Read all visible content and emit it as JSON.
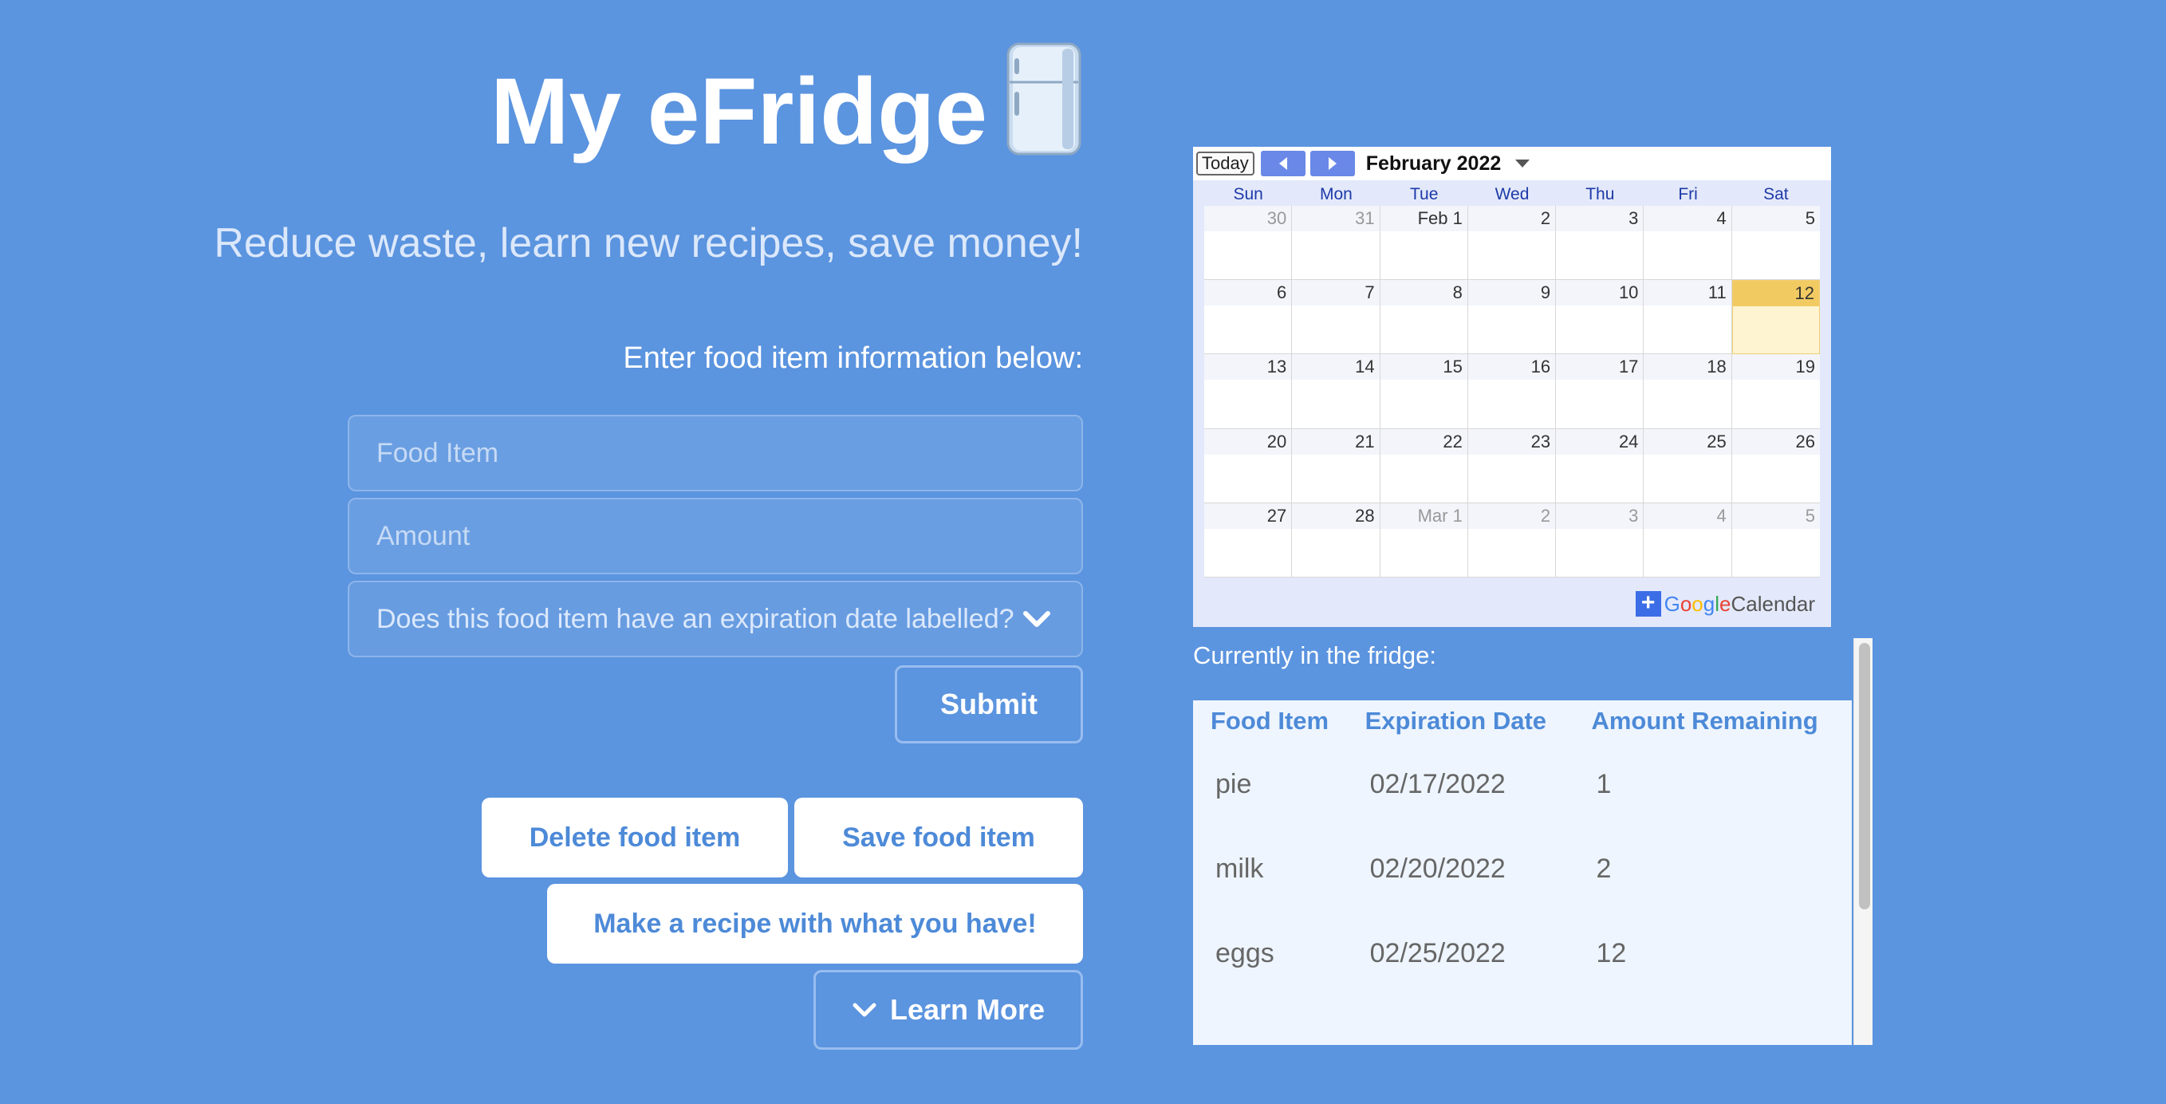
{
  "header": {
    "title": "My eFridge",
    "subtitle": "Reduce waste, learn new recipes, save money!"
  },
  "form": {
    "prompt": "Enter food item information below:",
    "food_item_placeholder": "Food Item",
    "amount_placeholder": "Amount",
    "expiration_select": "Does this food item have an expiration date labelled?",
    "submit_label": "Submit"
  },
  "actions": {
    "delete_label": "Delete food item",
    "save_label": "Save food item",
    "recipe_label": "Make a recipe with what you have!",
    "learn_more_label": "Learn More"
  },
  "calendar": {
    "today_label": "Today",
    "month_label": "February 2022",
    "weekdays": [
      "Sun",
      "Mon",
      "Tue",
      "Wed",
      "Thu",
      "Fri",
      "Sat"
    ],
    "weeks": [
      [
        {
          "d": "30",
          "o": true
        },
        {
          "d": "31",
          "o": true
        },
        {
          "d": "Feb 1"
        },
        {
          "d": "2"
        },
        {
          "d": "3"
        },
        {
          "d": "4"
        },
        {
          "d": "5"
        }
      ],
      [
        {
          "d": "6"
        },
        {
          "d": "7"
        },
        {
          "d": "8"
        },
        {
          "d": "9"
        },
        {
          "d": "10"
        },
        {
          "d": "11"
        },
        {
          "d": "12",
          "t": true
        }
      ],
      [
        {
          "d": "13"
        },
        {
          "d": "14"
        },
        {
          "d": "15"
        },
        {
          "d": "16"
        },
        {
          "d": "17"
        },
        {
          "d": "18"
        },
        {
          "d": "19"
        }
      ],
      [
        {
          "d": "20"
        },
        {
          "d": "21"
        },
        {
          "d": "22"
        },
        {
          "d": "23"
        },
        {
          "d": "24"
        },
        {
          "d": "25"
        },
        {
          "d": "26"
        }
      ],
      [
        {
          "d": "27"
        },
        {
          "d": "28"
        },
        {
          "d": "Mar 1",
          "o": true
        },
        {
          "d": "2",
          "o": true
        },
        {
          "d": "3",
          "o": true
        },
        {
          "d": "4",
          "o": true
        },
        {
          "d": "5",
          "o": true
        }
      ]
    ],
    "badge": {
      "google": "Google",
      "calendar": "Calendar"
    }
  },
  "fridge": {
    "label": "Currently in the fridge:",
    "columns": [
      "Food Item",
      "Expiration Date",
      "Amount Remaining"
    ],
    "rows": [
      [
        "pie",
        "02/17/2022",
        "1"
      ],
      [
        "milk",
        "02/20/2022",
        "2"
      ],
      [
        "eggs",
        "02/25/2022",
        "12"
      ]
    ]
  },
  "colors": {
    "background": "#5b94df",
    "accent": "#4d8ad8",
    "today_highlight": "#f2ca62"
  }
}
